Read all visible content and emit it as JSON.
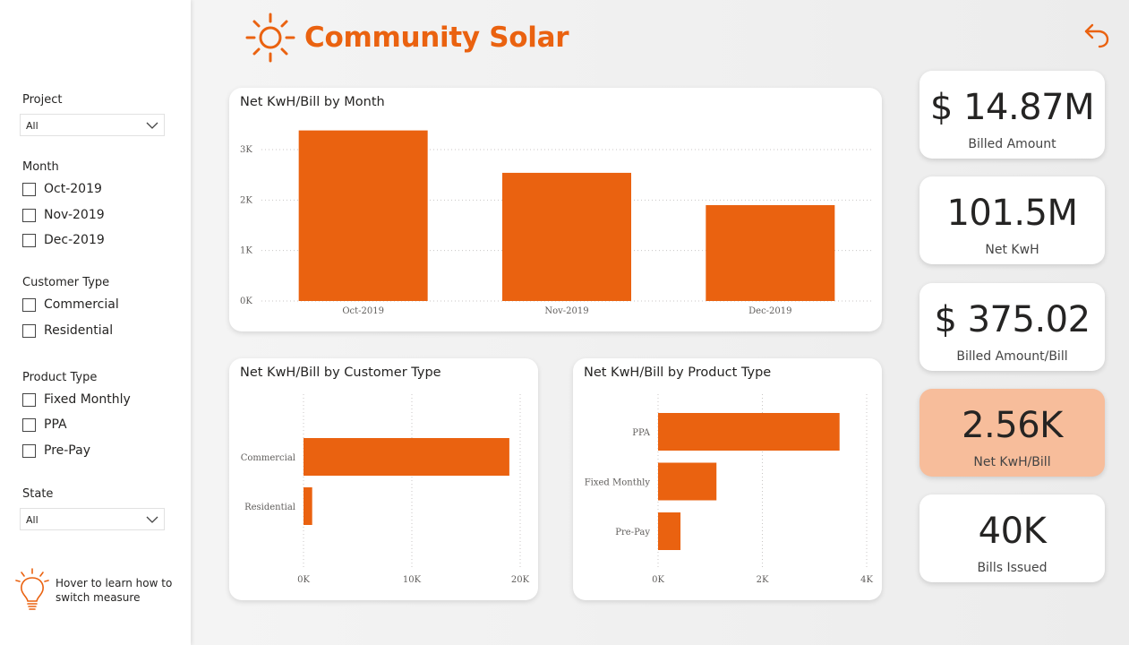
{
  "brand": {
    "title": "Community Solar",
    "accent": "#ea6210"
  },
  "filters": {
    "project": {
      "title": "Project",
      "value": "All"
    },
    "month": {
      "title": "Month",
      "options": [
        "Oct-2019",
        "Nov-2019",
        "Dec-2019"
      ]
    },
    "customer_type": {
      "title": "Customer Type",
      "options": [
        "Commercial",
        "Residential"
      ]
    },
    "product_type": {
      "title": "Product Type",
      "options": [
        "Fixed Monthly",
        "PPA",
        "Pre-Pay"
      ]
    },
    "state": {
      "title": "State",
      "value": "All"
    },
    "hint": {
      "line1": "Hover to learn how to",
      "line2": "switch measure"
    }
  },
  "kpis": [
    {
      "value": "$ 14.87M",
      "label": "Billed Amount",
      "active": false
    },
    {
      "value": "101.5M",
      "label": "Net KwH",
      "active": false
    },
    {
      "value": "$ 375.02",
      "label": "Billed Amount/Bill",
      "active": false
    },
    {
      "value": "2.56K",
      "label": "Net KwH/Bill",
      "active": true
    },
    {
      "value": "40K",
      "label": "Bills Issued",
      "active": false
    }
  ],
  "chart_data": [
    {
      "type": "bar",
      "title": "Net KwH/Bill by Month",
      "categories": [
        "Oct-2019",
        "Nov-2019",
        "Dec-2019"
      ],
      "values": [
        3380,
        2540,
        1900
      ],
      "ylim": [
        0,
        3000
      ],
      "yticks": [
        "0K",
        "1K",
        "2K",
        "3K"
      ],
      "grid": true,
      "color": "#ea6210"
    },
    {
      "type": "bar",
      "orientation": "horizontal",
      "title": "Net KwH/Bill by Customer Type",
      "categories": [
        "Commercial",
        "Residential"
      ],
      "values": [
        19000,
        800
      ],
      "xlim": [
        0,
        20000
      ],
      "xticks": [
        "0K",
        "10K",
        "20K"
      ],
      "grid": true,
      "color": "#ea6210"
    },
    {
      "type": "bar",
      "orientation": "horizontal",
      "title": "Net KwH/Bill by Product Type",
      "categories": [
        "PPA",
        "Fixed Monthly",
        "Pre-Pay"
      ],
      "values": [
        3480,
        1120,
        430
      ],
      "xlim": [
        0,
        4000
      ],
      "xticks": [
        "0K",
        "2K",
        "4K"
      ],
      "grid": true,
      "color": "#ea6210"
    }
  ]
}
